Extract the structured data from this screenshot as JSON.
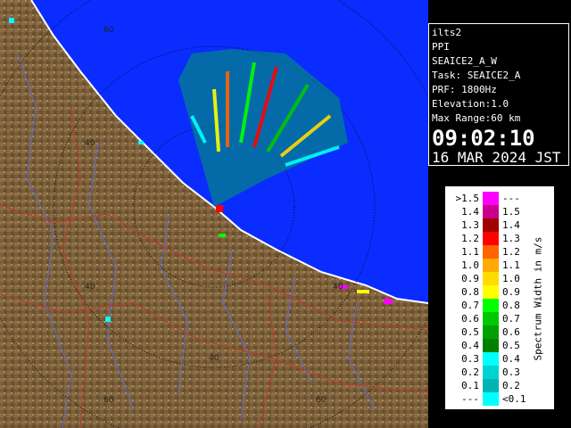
{
  "map": {
    "range_labels": [
      "60",
      "40",
      "40",
      "40",
      "40",
      "60",
      "60"
    ],
    "colors": {
      "sea": "#0b2cff",
      "land": "#7a5f3a",
      "land_light": "#a88c5c",
      "coast": "#ffffff",
      "river": "#5a6dd6",
      "border": "#c0392b",
      "rings": "#000000"
    }
  },
  "info": {
    "radar": "ilts2",
    "mode": "PPI",
    "scan": "SEAICE2_A_W",
    "task": "Task: SEAICE2_A",
    "prf": "PRF: 1800Hz",
    "elevation": "Elevation:1.0",
    "max_range": "Max Range:60 km",
    "time": "09:02:10",
    "date": "16 MAR 2024 JST"
  },
  "legend": {
    "title": "Spectrum Width in m/s",
    "rows": [
      {
        "lo": ">1.5",
        "hi": "---",
        "color": "#ff00ff"
      },
      {
        "lo": "1.4",
        "hi": "1.5",
        "color": "#c8008c"
      },
      {
        "lo": "1.3",
        "hi": "1.4",
        "color": "#a00000"
      },
      {
        "lo": "1.2",
        "hi": "1.3",
        "color": "#ff0000"
      },
      {
        "lo": "1.1",
        "hi": "1.2",
        "color": "#ff6400"
      },
      {
        "lo": "1.0",
        "hi": "1.1",
        "color": "#ffaa00"
      },
      {
        "lo": "0.9",
        "hi": "1.0",
        "color": "#ffdc00"
      },
      {
        "lo": "0.8",
        "hi": "0.9",
        "color": "#ffff00"
      },
      {
        "lo": "0.7",
        "hi": "0.8",
        "color": "#00ff00"
      },
      {
        "lo": "0.6",
        "hi": "0.7",
        "color": "#00c800"
      },
      {
        "lo": "0.5",
        "hi": "0.6",
        "color": "#00a000"
      },
      {
        "lo": "0.4",
        "hi": "0.5",
        "color": "#008000"
      },
      {
        "lo": "0.3",
        "hi": "0.4",
        "color": "#00ffff"
      },
      {
        "lo": "0.2",
        "hi": "0.3",
        "color": "#00d2d2"
      },
      {
        "lo": "0.1",
        "hi": "0.2",
        "color": "#00b4b4"
      },
      {
        "lo": "---",
        "hi": "<0.1",
        "color": "#00ffff"
      }
    ]
  }
}
